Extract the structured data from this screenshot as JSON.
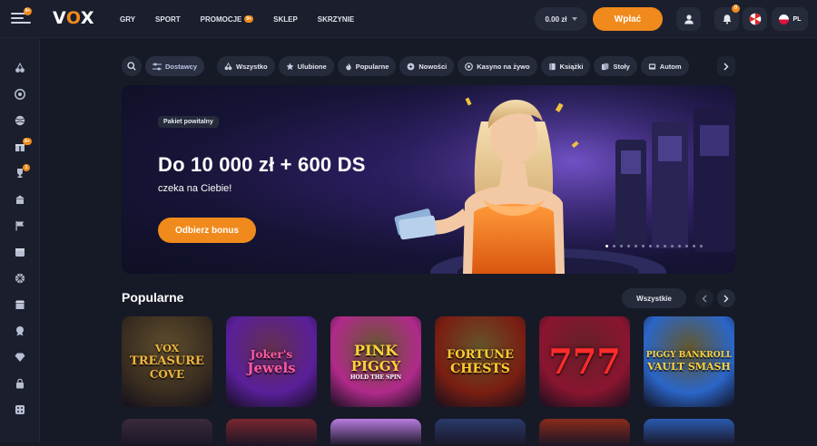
{
  "header": {
    "menu_badge": "9+",
    "logo": {
      "v": "V",
      "o": "O",
      "x": "X"
    },
    "nav": [
      {
        "label": "GRY"
      },
      {
        "label": "SPORT"
      },
      {
        "label": "PROMOCJE",
        "badge": "9+"
      },
      {
        "label": "SKLEP"
      },
      {
        "label": "SKRZYNIE"
      }
    ],
    "balance": "0.00 zł",
    "deposit_label": "Wpłać",
    "notifications_count": "0",
    "language": "PL"
  },
  "sidebar": {
    "items": [
      {
        "icon": "cherries-icon"
      },
      {
        "icon": "chip-icon"
      },
      {
        "icon": "ball-icon"
      },
      {
        "icon": "gift-icon",
        "badge": "9+"
      },
      {
        "icon": "trophy-icon",
        "badge": "1"
      },
      {
        "icon": "building-icon"
      },
      {
        "icon": "flag-icon"
      },
      {
        "icon": "calendar-icon"
      },
      {
        "icon": "wheel-icon"
      },
      {
        "icon": "shop-icon"
      },
      {
        "icon": "medal-icon"
      },
      {
        "icon": "diamond-icon"
      },
      {
        "icon": "lock-icon"
      },
      {
        "icon": "dice-icon"
      }
    ]
  },
  "filters": {
    "providers": "Dostawcy",
    "chips": [
      {
        "label": "Wszystko",
        "icon": "cherries-icon"
      },
      {
        "label": "Ulubione",
        "icon": "star-icon"
      },
      {
        "label": "Popularne",
        "icon": "fire-icon"
      },
      {
        "label": "Nowości",
        "icon": "sparkle-icon"
      },
      {
        "label": "Kasyno na żywo",
        "icon": "chip-icon"
      },
      {
        "label": "Książki",
        "icon": "book-icon"
      },
      {
        "label": "Stoły",
        "icon": "cards-icon"
      },
      {
        "label": "Autom",
        "icon": "slot-icon"
      }
    ]
  },
  "banner": {
    "badge": "Pakiet powitalny",
    "title": "Do 10 000 zł + 600 DS",
    "subtitle": "czeka na Ciebie!",
    "cta": "Odbierz bonus",
    "slides_total": 14,
    "slides_active": 1
  },
  "popular": {
    "title": "Popularne",
    "see_all": "Wszystkie",
    "games": [
      {
        "line1": "VOX",
        "line2": "TREASURE",
        "line3": "COVE",
        "bg": "#3a2d20",
        "accent": "#f0b53c"
      },
      {
        "line1": "Joker's",
        "line2": "Jewels",
        "line3": "",
        "bg": "#5a1f9a",
        "accent": "#ff5aa0"
      },
      {
        "line1": "PINK",
        "line2": "PIGGY",
        "line3": "HOLD THE SPIN",
        "bg": "#b02a8a",
        "accent": "#ffd23a"
      },
      {
        "line1": "FORTUNE",
        "line2": "CHESTS",
        "line3": "",
        "bg": "#7a1e12",
        "accent": "#ffcc33"
      },
      {
        "line1": "777",
        "line2": "",
        "line3": "",
        "bg": "#8a1530",
        "accent": "#ff2b2b"
      },
      {
        "line1": "PIGGY BANKROLL",
        "line2": "VAULT SMASH",
        "line3": "",
        "bg": "#2b66c8",
        "accent": "#ffd23a"
      }
    ],
    "row2_colors": [
      "#3a2a3a",
      "#7a2630",
      "#b87be0",
      "#2a3a6a",
      "#8a2a1a",
      "#2a5ab0"
    ]
  }
}
